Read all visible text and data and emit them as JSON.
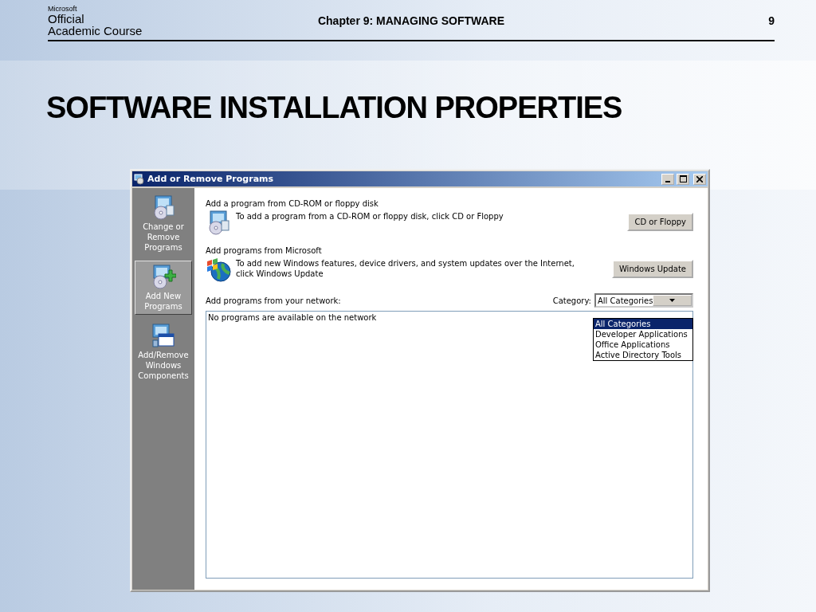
{
  "slide": {
    "logo": [
      "Microsoft",
      "Official",
      "Academic Course"
    ],
    "chapter": "Chapter 9: MANAGING SOFTWARE",
    "page": "9",
    "title": "SOFTWARE INSTALLATION PROPERTIES"
  },
  "window": {
    "title": "Add or Remove Programs"
  },
  "sidebar": {
    "items": [
      {
        "label": "Change or Remove Programs",
        "kind": "change",
        "selected": false
      },
      {
        "label": "Add New Programs",
        "kind": "add",
        "selected": true
      },
      {
        "label": "Add/Remove Windows Components",
        "kind": "components",
        "selected": false
      }
    ]
  },
  "sections": [
    {
      "heading": "Add a program from CD-ROM or floppy disk",
      "kind": "cd",
      "description": "To add a program from a CD-ROM or floppy disk, click CD or Floppy",
      "button": "CD or Floppy"
    },
    {
      "heading": "Add programs from Microsoft",
      "kind": "update",
      "description": "To add new Windows features, device drivers, and system updates over the Internet, click Windows Update",
      "button": "Windows Update"
    }
  ],
  "network": {
    "heading": "Add programs from your network:",
    "category_label": "Category:",
    "category_value": "All Categories",
    "options": [
      {
        "label": "All Categories",
        "selected": true
      },
      {
        "label": "Developer Applications",
        "selected": false
      },
      {
        "label": "Office Applications",
        "selected": false
      },
      {
        "label": "Active Directory Tools",
        "selected": false
      }
    ],
    "list_message": "No programs are available on the network"
  }
}
